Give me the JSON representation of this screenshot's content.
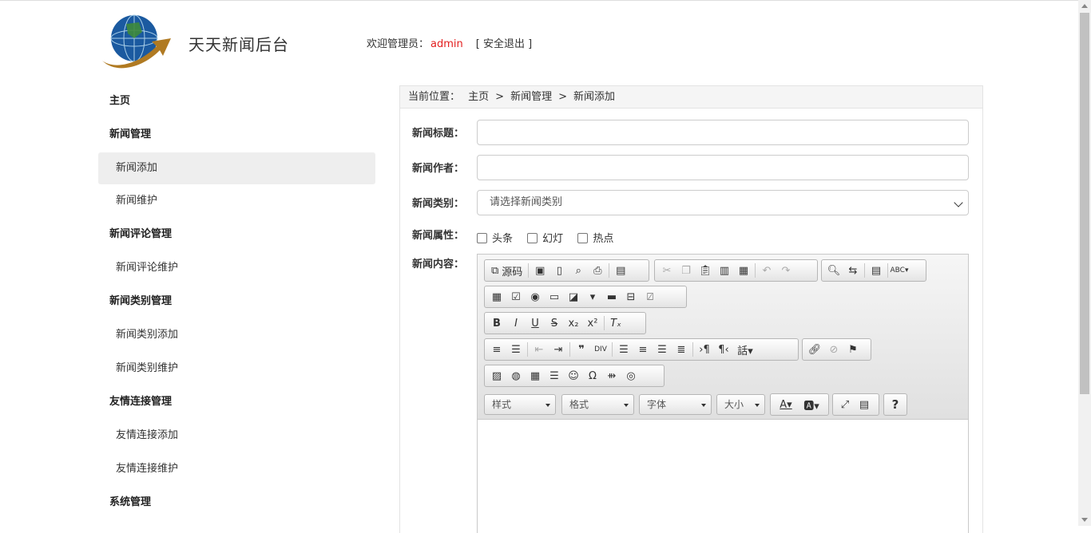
{
  "header": {
    "site_title": "天天新闻后台",
    "welcome_prefix": "欢迎管理员：",
    "username": "admin",
    "logout": "[ 安全退出 ]"
  },
  "sidebar": {
    "home": "主页",
    "groups": [
      {
        "title": "新闻管理",
        "items": [
          "新闻添加",
          "新闻维护"
        ]
      },
      {
        "title": "新闻评论管理",
        "items": [
          "新闻评论维护"
        ]
      },
      {
        "title": "新闻类别管理",
        "items": [
          "新闻类别添加",
          "新闻类别维护"
        ]
      },
      {
        "title": "友情连接管理",
        "items": [
          "友情连接添加",
          "友情连接维护"
        ]
      },
      {
        "title": "系统管理",
        "items": []
      }
    ],
    "active_item": "新闻添加"
  },
  "breadcrumb": {
    "label": "当前位置：",
    "items": [
      "主页",
      "新闻管理",
      "新闻添加"
    ],
    "separator": ">"
  },
  "form": {
    "title_label": "新闻标题：",
    "title_value": "",
    "author_label": "新闻作者：",
    "author_value": "",
    "category_label": "新闻类别：",
    "category_selected": "请选择新闻类别",
    "attr_label": "新闻属性：",
    "attributes": [
      "头条",
      "幻灯",
      "热点"
    ],
    "content_label": "新闻内容："
  },
  "editor": {
    "source_label": "源码",
    "combos": {
      "style": "样式",
      "format": "格式",
      "font": "字体",
      "size": "大小"
    },
    "help": "?"
  },
  "colors": {
    "username": "#e21e1e",
    "active_bg": "#eeeeee"
  }
}
